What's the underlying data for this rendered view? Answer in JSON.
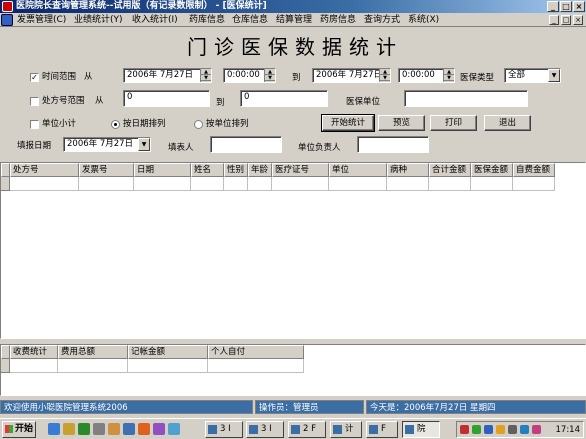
{
  "window": {
    "title": "医院院长查询管理系统--试用版（有记录数限制） - [医保统计]",
    "min": "_",
    "max": "□",
    "close": "×"
  },
  "menu": {
    "items": [
      "发票管理(C)",
      "业绩统计(Y)",
      "收入统计(I)",
      "药库信息",
      "仓库信息",
      "结算管理",
      "药房信息",
      "查询方式",
      "系统(X)"
    ],
    "mdi": [
      "_",
      "□",
      "×"
    ]
  },
  "form": {
    "title": "门诊医保数据统计",
    "time_range": {
      "label": "时间范围",
      "from": "从",
      "to": "到",
      "checked": true,
      "from_date": "2006年 7月27日",
      "from_time": "0:00:00",
      "to_date": "2006年 7月27日",
      "to_time": "0:00:00"
    },
    "insurance_type": {
      "label": "医保类型",
      "value": "全部"
    },
    "rx_range": {
      "label": "处方号范围",
      "from": "从",
      "to": "到",
      "checked": false,
      "from_value": "0",
      "to_value": "0"
    },
    "insurance_unit": {
      "label": "医保单位",
      "value": ""
    },
    "unit_subtotal": {
      "label": "单位小计",
      "checked": false
    },
    "sort_date": {
      "label": "按日期排列",
      "selected": true
    },
    "sort_unit": {
      "label": "按单位排列",
      "selected": false
    },
    "buttons": {
      "start": "开始统计",
      "preview": "预览",
      "print": "打印",
      "exit": "退出"
    },
    "fill_date": {
      "label": "填报日期",
      "value": "2006年 7月27日"
    },
    "filler": {
      "label": "填表人",
      "value": ""
    },
    "unit_head": {
      "label": "单位负责人",
      "value": ""
    }
  },
  "main_grid": {
    "columns": [
      "处方号",
      "发票号",
      "日期",
      "姓名",
      "性别",
      "年龄",
      "医疗证号",
      "单位",
      "病种",
      "合计金额",
      "医保金额",
      "自费金额"
    ]
  },
  "summary_grid": {
    "columns": [
      "收费统计",
      "费用总额",
      "记帐金额",
      "个人自付"
    ]
  },
  "status": {
    "welcome": "欢迎使用小聪医院管理系统2006",
    "operator": "操作员：管理员",
    "today": "今天是：2006年7月27日 星期四"
  },
  "taskbar": {
    "start": "开始",
    "tasks": [
      "3 I",
      "3 I",
      "2 F",
      "计",
      "F",
      "院"
    ],
    "clock": "17:14"
  }
}
